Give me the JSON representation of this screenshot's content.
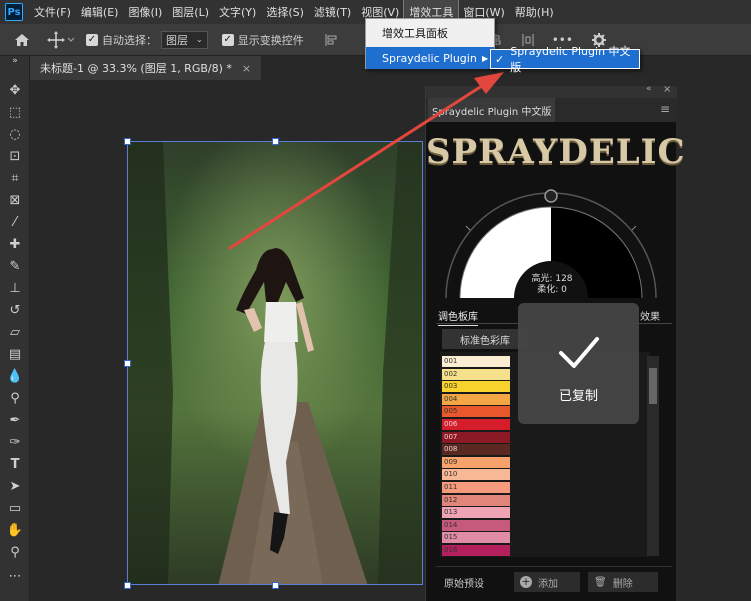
{
  "app": {
    "logo": "Ps",
    "menus": [
      "文件(F)",
      "编辑(E)",
      "图像(I)",
      "图层(L)",
      "文字(Y)",
      "选择(S)",
      "滤镜(T)",
      "视图(V)",
      "增效工具",
      "窗口(W)",
      "帮助(H)"
    ],
    "active_menu": "增效工具"
  },
  "options_bar": {
    "auto_select_label": "自动选择：",
    "auto_select_value": "图层",
    "transform_label": "显示变换控件",
    "more": "•••"
  },
  "document": {
    "tab_title": "未标题-1 @ 33.3% (图层 1, RGB/8) *",
    "close": "×"
  },
  "dropdown": {
    "items": [
      "增效工具面板",
      "Spraydelic Plugin"
    ],
    "submenu_item": "Spraydelic Plugin 中文版",
    "check": "✓",
    "arrow": "▶"
  },
  "panel": {
    "tab_title": "Spraydelic Plugin 中文版",
    "logo": "SPRAYDELIC",
    "highlight_label": "高光: 128",
    "softness_label": "柔化: 0",
    "tabs": [
      "调色板库",
      "效果"
    ],
    "standard_button": "标准色彩库",
    "swatches": [
      {
        "label": "001",
        "color": "#fbeed3"
      },
      {
        "label": "002",
        "color": "#f7e08b"
      },
      {
        "label": "003",
        "color": "#f7d32b"
      },
      {
        "label": "004",
        "color": "#f3a643"
      },
      {
        "label": "005",
        "color": "#e9582c"
      },
      {
        "label": "006",
        "color": "#d61d2a"
      },
      {
        "label": "007",
        "color": "#8c1a24"
      },
      {
        "label": "008",
        "color": "#5a2a22"
      },
      {
        "label": "009",
        "color": "#f6a26a"
      },
      {
        "label": "010",
        "color": "#f7b896"
      },
      {
        "label": "011",
        "color": "#f59a7c"
      },
      {
        "label": "012",
        "color": "#e1857a"
      },
      {
        "label": "013",
        "color": "#f0a3b4"
      },
      {
        "label": "014",
        "color": "#c55a7d"
      },
      {
        "label": "015",
        "color": "#e08ca7"
      },
      {
        "label": "016",
        "color": "#b3205b"
      }
    ],
    "preset_label": "原始预设",
    "add_label": "添加",
    "delete_label": "删除"
  },
  "toast": {
    "label": "已复制",
    "icon": "✓"
  },
  "colors": {
    "accent": "#1f6fd1",
    "arrow": "#e2473d"
  }
}
